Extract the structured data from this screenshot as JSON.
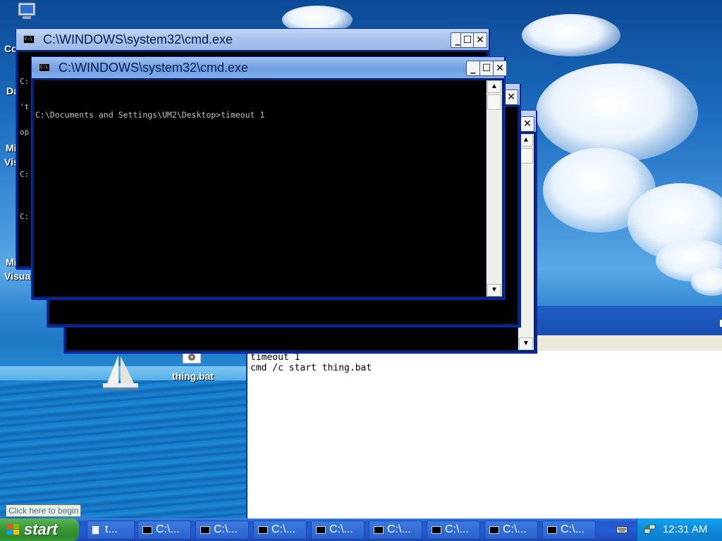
{
  "desktop": {
    "icon_labels": [
      "Co",
      "Da",
      "Mi",
      "Visu",
      "Mi",
      "Visua"
    ],
    "file_icon": {
      "label": "thing.bat",
      "icon": "batch-file-icon"
    }
  },
  "windows": {
    "back": {
      "title": "C:\\WINDOWS\\system32\\cmd.exe",
      "lines": [
        "C:",
        "'t",
        "op",
        "",
        "C:",
        "",
        "C:"
      ],
      "buttons": {
        "minimize": "_",
        "maximize": "☐",
        "close": "✕"
      }
    },
    "mid_close": "✕",
    "right": {
      "buttons": {
        "maximize": "☐",
        "close": "✕"
      }
    },
    "front": {
      "title": "C:\\WINDOWS\\system32\\cmd.exe",
      "text": "C:\\Documents and Settings\\UM2\\Desktop>timeout 1",
      "buttons": {
        "minimize": "_",
        "maximize": "☐",
        "close": "✕"
      }
    }
  },
  "notepad": {
    "lines": [
      "timeout 1",
      "cmd /c start thing.bat"
    ]
  },
  "tooltip": "Click here to begin",
  "taskbar": {
    "start_label": "start",
    "tasks": [
      {
        "label": "t...",
        "icon": "notepad-icon"
      },
      {
        "label": "C:\\...",
        "icon": "cmd-icon"
      },
      {
        "label": "C:\\...",
        "icon": "cmd-icon"
      },
      {
        "label": "C:\\...",
        "icon": "cmd-icon"
      },
      {
        "label": "C:\\...",
        "icon": "cmd-icon"
      },
      {
        "label": "C:\\...",
        "icon": "cmd-icon"
      },
      {
        "label": "C:\\...",
        "icon": "cmd-icon"
      },
      {
        "label": "C:\\...",
        "icon": "cmd-icon"
      },
      {
        "label": "C:\\...",
        "icon": "cmd-icon"
      }
    ],
    "clock": "12:31 AM"
  },
  "colors": {
    "title_active": "#7fa9e6",
    "console_bg": "#000000",
    "console_fg": "#c0c0c0",
    "taskbar": "#245dd7",
    "start_green": "#3c9a38"
  }
}
